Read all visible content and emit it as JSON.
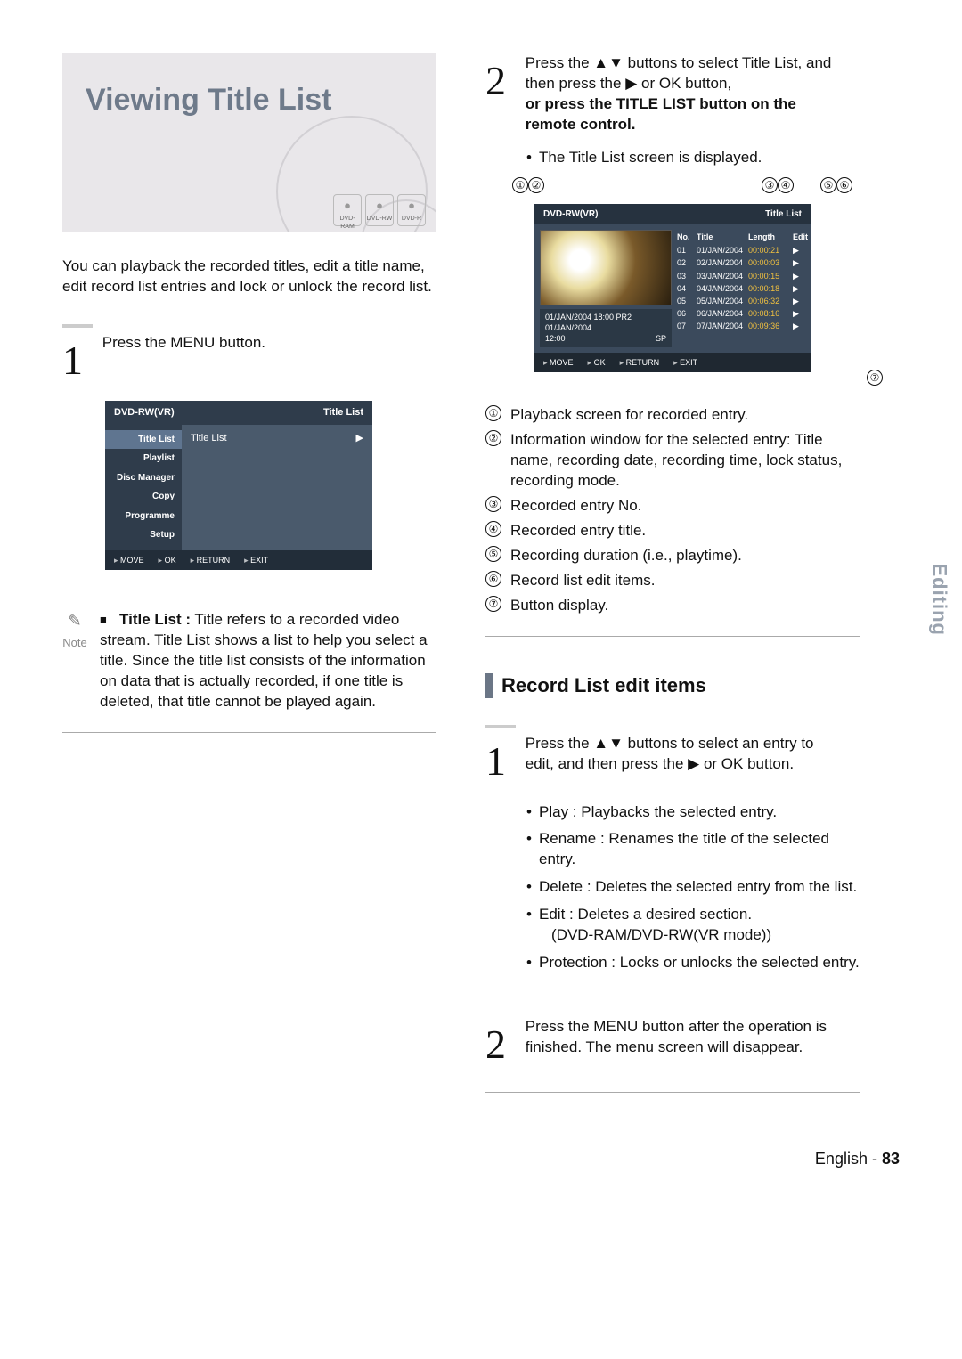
{
  "page": {
    "lang_label": "English",
    "page_number": "83",
    "side_tab": "Editing"
  },
  "title_box": {
    "heading": "Viewing Title List",
    "badges": [
      "DVD-RAM",
      "DVD-RW",
      "DVD-R"
    ]
  },
  "intro": "You can playback the recorded titles, edit a title name, edit record list entries and lock or unlock the record list.",
  "left": {
    "step1_num": "1",
    "step1_text": "Press the MENU button.",
    "menu_screen": {
      "hdr_left": "DVD-RW(VR)",
      "hdr_right": "Title List",
      "side": [
        "Title List",
        "Playlist",
        "Disc Manager",
        "Copy",
        "Programme",
        "Setup"
      ],
      "main_item": "Title List",
      "main_arrow": "▶",
      "ftr": [
        "MOVE",
        "OK",
        "RETURN",
        "EXIT"
      ]
    },
    "note_label": "Note",
    "note_marker": "■",
    "note_lead": "Title List :",
    "note_body": " Title refers to a recorded video stream. Title List shows a list to help you select a title. Since the title list consists of the information on data that is actually recorded, if one title is deleted, that title cannot be played again."
  },
  "right": {
    "step2_num": "2",
    "step2_line1a": "Press the ",
    "step2_line1_arrows": "▲▼",
    "step2_line1b": " buttons to select Title List, and then press the ",
    "step2_line1_right": "▶",
    "step2_line1c": " or OK button,",
    "step2_bold": "or press the TITLE LIST button on the remote control.",
    "step2_bullet": "The Title List screen is displayed.",
    "callout_labels": [
      "①",
      "②",
      "③",
      "④",
      "⑤",
      "⑥",
      "⑦"
    ],
    "tl_screen": {
      "hdr_left": "DVD-RW(VR)",
      "hdr_right": "Title List",
      "meta": {
        "line1_left": "01/JAN/2004 18:00 PR2",
        "line2_left": "01/JAN/2004",
        "line3_left": "12:00",
        "line3_right": "SP"
      },
      "table_hdr": {
        "no": "No.",
        "title": "Title",
        "length": "Length",
        "edit": "Edit"
      },
      "rows": [
        {
          "no": "01",
          "title": "01/JAN/2004",
          "length": "00:00:21",
          "edit": "▶"
        },
        {
          "no": "02",
          "title": "02/JAN/2004",
          "length": "00:00:03",
          "edit": "▶"
        },
        {
          "no": "03",
          "title": "03/JAN/2004",
          "length": "00:00:15",
          "edit": "▶"
        },
        {
          "no": "04",
          "title": "04/JAN/2004",
          "length": "00:00:18",
          "edit": "▶"
        },
        {
          "no": "05",
          "title": "05/JAN/2004",
          "length": "00:06:32",
          "edit": "▶"
        },
        {
          "no": "06",
          "title": "06/JAN/2004",
          "length": "00:08:16",
          "edit": "▶"
        },
        {
          "no": "07",
          "title": "07/JAN/2004",
          "length": "00:09:36",
          "edit": "▶"
        }
      ],
      "ftr": [
        "MOVE",
        "OK",
        "RETURN",
        "EXIT"
      ]
    },
    "legend": [
      {
        "n": "①",
        "t": "Playback screen for recorded entry."
      },
      {
        "n": "②",
        "t": "Information window for the selected entry: Title name, recording date, recording time, lock status, recording mode."
      },
      {
        "n": "③",
        "t": "Recorded entry No."
      },
      {
        "n": "④",
        "t": "Recorded entry title."
      },
      {
        "n": "⑤",
        "t": "Recording duration (i.e., playtime)."
      },
      {
        "n": "⑥",
        "t": "Record list edit items."
      },
      {
        "n": "⑦",
        "t": "Button display."
      }
    ],
    "section_title": "Record List edit items",
    "rstep1_num": "1",
    "rstep1_a": "Press the ",
    "rstep1_arrows": "▲▼",
    "rstep1_b": " buttons to select an entry to edit, and then press the ",
    "rstep1_right": "▶",
    "rstep1_c": " or OK button.",
    "rbullets": [
      "Play : Playbacks the selected entry.",
      "Rename : Renames the title of the selected entry.",
      "Delete : Deletes the selected entry from the list.",
      "Edit : Deletes a desired section.",
      "Protection : Locks or unlocks the selected entry."
    ],
    "rbullet_edit_sub": "(DVD-RAM/DVD-RW(VR mode))",
    "rstep2_num": "2",
    "rstep2_text": "Press the MENU button after the operation is finished. The menu screen will disappear."
  }
}
